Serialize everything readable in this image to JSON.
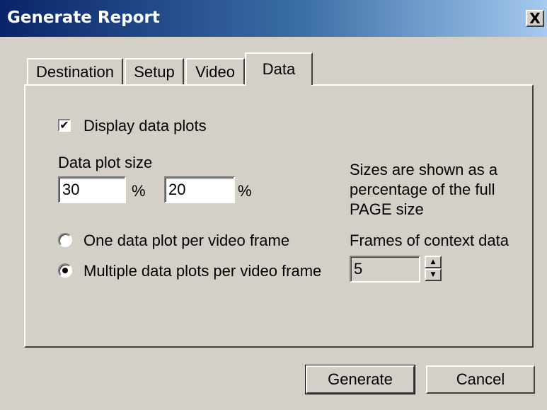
{
  "window": {
    "title": "Generate Report",
    "close_glyph": "X"
  },
  "tabs": [
    {
      "label": "Destination",
      "active": false
    },
    {
      "label": "Setup",
      "active": false
    },
    {
      "label": "Video",
      "active": false
    },
    {
      "label": "Data",
      "active": true
    }
  ],
  "data_tab": {
    "display_plots": {
      "label": "Display data plots",
      "checked": true,
      "glyph": "✔"
    },
    "plot_size": {
      "label": "Data plot size",
      "width_value": "30",
      "height_value": "20",
      "unit": "%"
    },
    "note": {
      "line1": "Sizes are shown as a",
      "line2": "percentage of the full",
      "line3": "PAGE size"
    },
    "plot_mode": {
      "options": [
        {
          "label": "One data plot per video frame",
          "selected": false
        },
        {
          "label": "Multiple data plots per video frame",
          "selected": true
        }
      ]
    },
    "context_frames": {
      "label": "Frames of context data",
      "value": "5",
      "up_glyph": "▲",
      "down_glyph": "▼"
    }
  },
  "buttons": {
    "generate": "Generate",
    "cancel": "Cancel"
  },
  "colors": {
    "face": "#d4d0c8",
    "title_start": "#0a246a",
    "title_end": "#a6caf0"
  }
}
